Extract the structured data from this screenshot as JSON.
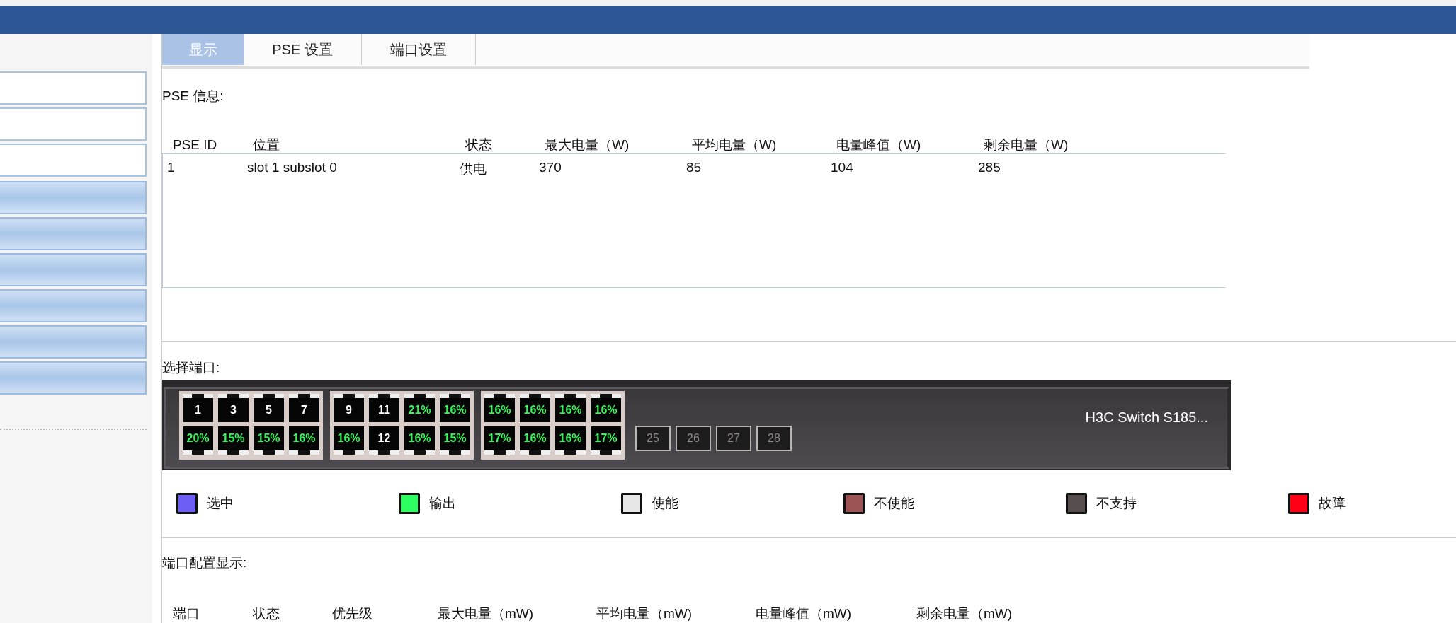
{
  "sidebar": {
    "items": [
      {
        "kind": "plain"
      },
      {
        "kind": "plain"
      },
      {
        "kind": "plain"
      },
      {
        "kind": "shaded"
      },
      {
        "kind": "shaded"
      },
      {
        "kind": "shaded"
      },
      {
        "kind": "shaded"
      },
      {
        "kind": "shaded"
      },
      {
        "kind": "shaded"
      }
    ]
  },
  "tabs": [
    {
      "label": "显示",
      "selected": true
    },
    {
      "label": "PSE 设置",
      "selected": false
    },
    {
      "label": "端口设置",
      "selected": false
    }
  ],
  "pse_info": {
    "title": "PSE 信息:",
    "columns": [
      "PSE ID",
      "位置",
      "状态",
      "最大电量（W)",
      "平均电量（W)",
      "电量峰值（W)",
      "剩余电量（W)"
    ],
    "rows": [
      [
        "1",
        "slot 1 subslot 0",
        "供电",
        "370",
        "85",
        "104",
        "285"
      ]
    ]
  },
  "port_select": {
    "title": "选择端口:",
    "device_name": "H3C Switch S185...",
    "groups": [
      {
        "kind": "block",
        "rows": [
          [
            {
              "label": "1",
              "kind": "idle"
            },
            {
              "label": "3",
              "kind": "idle"
            },
            {
              "label": "5",
              "kind": "idle"
            },
            {
              "label": "7",
              "kind": "idle"
            }
          ],
          [
            {
              "label": "20%",
              "kind": "output"
            },
            {
              "label": "15%",
              "kind": "output"
            },
            {
              "label": "15%",
              "kind": "output"
            },
            {
              "label": "16%",
              "kind": "output"
            }
          ]
        ]
      },
      {
        "kind": "block",
        "rows": [
          [
            {
              "label": "9",
              "kind": "idle"
            },
            {
              "label": "11",
              "kind": "idle"
            },
            {
              "label": "21%",
              "kind": "output"
            },
            {
              "label": "16%",
              "kind": "output"
            }
          ],
          [
            {
              "label": "16%",
              "kind": "output"
            },
            {
              "label": "12",
              "kind": "idle"
            },
            {
              "label": "16%",
              "kind": "output"
            },
            {
              "label": "15%",
              "kind": "output"
            }
          ]
        ]
      },
      {
        "kind": "block",
        "rows": [
          [
            {
              "label": "16%",
              "kind": "output"
            },
            {
              "label": "16%",
              "kind": "output"
            },
            {
              "label": "16%",
              "kind": "output"
            },
            {
              "label": "16%",
              "kind": "output"
            }
          ],
          [
            {
              "label": "17%",
              "kind": "output"
            },
            {
              "label": "16%",
              "kind": "output"
            },
            {
              "label": "16%",
              "kind": "output"
            },
            {
              "label": "17%",
              "kind": "output"
            }
          ]
        ]
      },
      {
        "kind": "loose",
        "rows": [
          [
            {
              "label": "25",
              "kind": "unsupported"
            },
            {
              "label": "26",
              "kind": "unsupported"
            },
            {
              "label": "27",
              "kind": "unsupported"
            },
            {
              "label": "28",
              "kind": "unsupported"
            }
          ]
        ]
      }
    ],
    "legend": [
      {
        "label": "选中",
        "color": "#6b5ff5"
      },
      {
        "label": "输出",
        "color": "#2eff62"
      },
      {
        "label": "使能",
        "color": "#e6e6e6"
      },
      {
        "label": "不使能",
        "color": "#9c5454"
      },
      {
        "label": "不支持",
        "color": "#564d4d"
      },
      {
        "label": "故障",
        "color": "#ff0016"
      }
    ]
  },
  "port_config": {
    "title": "端口配置显示:",
    "columns": [
      "端口",
      "状态",
      "优先级",
      "最大电量（mW)",
      "平均电量（mW)",
      "电量峰值（mW)",
      "剩余电量（mW)"
    ]
  }
}
